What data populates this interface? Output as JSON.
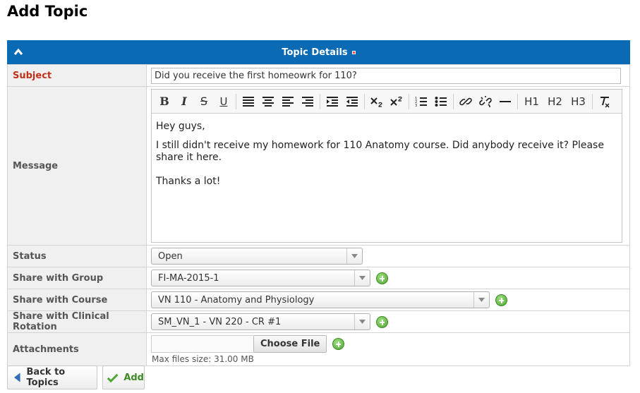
{
  "page": {
    "title": "Add Topic"
  },
  "panel": {
    "title": "Topic Details"
  },
  "form": {
    "subject": {
      "label": "Subject",
      "value": "Did you receive the first homeowrk for 110?"
    },
    "message": {
      "label": "Message",
      "toolbar": [
        "B",
        "I",
        "S",
        "U",
        "H1",
        "H2",
        "H3"
      ],
      "body": [
        "Hey guys,",
        "I still didn't receive my homework for 110 Anatomy course. Did anybody receive it? Please share it here.",
        "Thanks a lot!"
      ]
    },
    "status": {
      "label": "Status",
      "value": "Open"
    },
    "group": {
      "label": "Share with Group",
      "value": "FI-MA-2015-1"
    },
    "course": {
      "label": "Share with Course",
      "value": "VN 110 - Anatomy and Physiology"
    },
    "rotation": {
      "label": "Share with Clinical Rotation",
      "value": "SM_VN_1 - VN 220 - CR #1"
    },
    "attachments": {
      "label": "Attachments",
      "button": "Choose File",
      "hint": "Max files size: 31.00 MB"
    }
  },
  "actions": {
    "back": "Back to Topics",
    "add": "Add"
  },
  "colors": {
    "header": "#0a6ab3",
    "required_label": "#c0311a",
    "add_icon": "#4ea632"
  }
}
